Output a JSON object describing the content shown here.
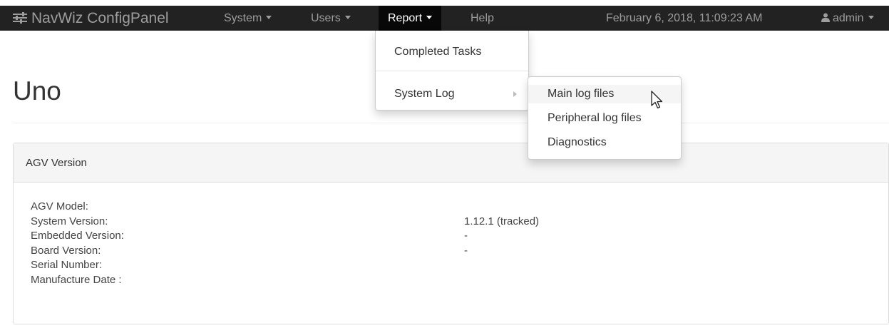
{
  "navbar": {
    "brand": "NavWiz ConfigPanel",
    "brand_icon": "sliders-icon",
    "menus": [
      {
        "label": "System",
        "has_caret": true
      },
      {
        "label": "Users",
        "has_caret": true
      },
      {
        "label": "Report",
        "has_caret": true,
        "active": true
      },
      {
        "label": "Help",
        "has_caret": false
      }
    ],
    "datetime": "February 6, 2018, 11:09:23 AM",
    "user": "admin",
    "user_icon": "user-icon"
  },
  "report_menu": {
    "completed_tasks": "Completed Tasks",
    "system_log": "System Log"
  },
  "system_log_menu": {
    "items": [
      "Main log files",
      "Peripheral log files",
      "Diagnostics"
    ],
    "hovered": "Main log files"
  },
  "page": {
    "title": "Uno"
  },
  "agv_panel": {
    "heading": "AGV Version",
    "rows": [
      {
        "label": "AGV Model:",
        "value": ""
      },
      {
        "label": "System Version:",
        "value": "1.12.1 (tracked)"
      },
      {
        "label": "Embedded Version:",
        "value": "-"
      },
      {
        "label": "Board Version:",
        "value": "-"
      },
      {
        "label": "Serial Number:",
        "value": ""
      },
      {
        "label": "Manufacture Date :",
        "value": ""
      }
    ]
  },
  "colors": {
    "navbar_bg": "#222222",
    "navbar_active_bg": "#080808",
    "navbar_text": "#9d9d9d",
    "panel_heading_bg": "#f5f5f5",
    "border": "#dddddd"
  }
}
